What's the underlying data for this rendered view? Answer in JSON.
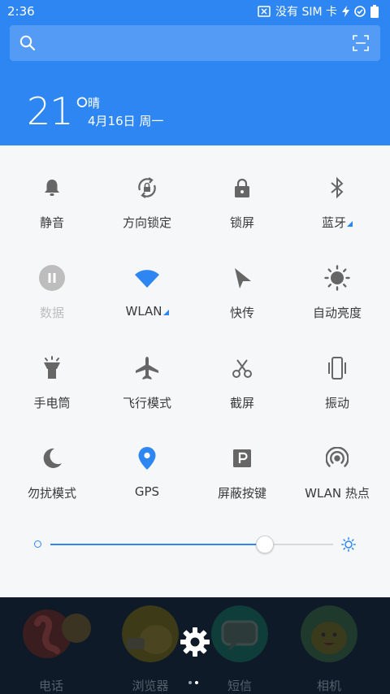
{
  "status_bar": {
    "time": "2:36",
    "no_sim": "没有 SIM 卡"
  },
  "weather": {
    "temperature": "21°",
    "condition": "晴",
    "date": "4月16日 周一"
  },
  "tiles": [
    {
      "label": "静音",
      "icon": "bell-icon"
    },
    {
      "label": "方向锁定",
      "icon": "rotation-lock-icon"
    },
    {
      "label": "锁屏",
      "icon": "lock-icon"
    },
    {
      "label": "蓝牙",
      "icon": "bluetooth-icon"
    },
    {
      "label": "数据",
      "icon": "pause-data-icon"
    },
    {
      "label": "WLAN",
      "icon": "wifi-icon"
    },
    {
      "label": "快传",
      "icon": "send-cursor-icon"
    },
    {
      "label": "自动亮度",
      "icon": "brightness-icon"
    },
    {
      "label": "手电筒",
      "icon": "flashlight-icon"
    },
    {
      "label": "飞行模式",
      "icon": "airplane-icon"
    },
    {
      "label": "截屏",
      "icon": "scissors-icon"
    },
    {
      "label": "振动",
      "icon": "vibrate-icon"
    },
    {
      "label": "勿扰模式",
      "icon": "moon-icon"
    },
    {
      "label": "GPS",
      "icon": "location-pin-icon"
    },
    {
      "label": "屏蔽按键",
      "icon": "parking-p-icon"
    },
    {
      "label": "WLAN 热点",
      "icon": "hotspot-icon"
    }
  ],
  "brightness": {
    "level": 0.76
  },
  "dock": [
    {
      "label": "电话"
    },
    {
      "label": "浏览器"
    },
    {
      "label": "短信"
    },
    {
      "label": "相机"
    }
  ],
  "colors": {
    "accent": "#2e86f2",
    "header": "#2e86f2",
    "panel": "#f6f7f9"
  }
}
